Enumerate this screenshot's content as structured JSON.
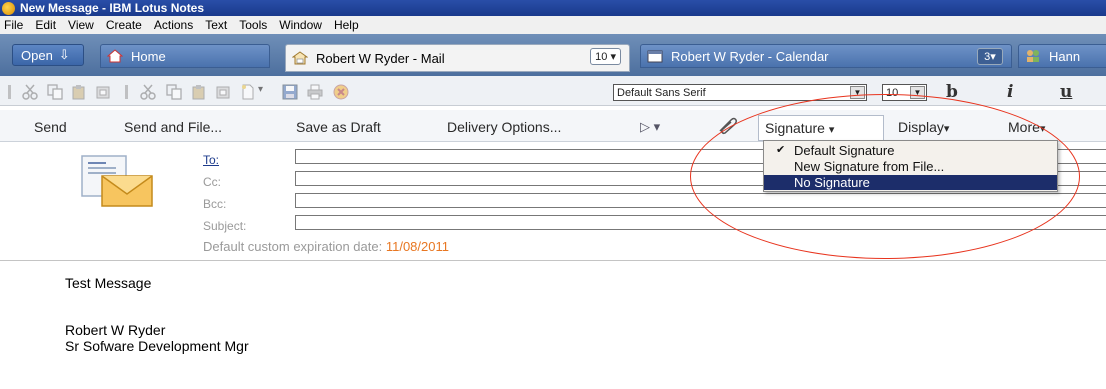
{
  "window": {
    "title": "New Message - IBM Lotus Notes"
  },
  "menubar": {
    "items": [
      "File",
      "Edit",
      "View",
      "Create",
      "Actions",
      "Text",
      "Tools",
      "Window",
      "Help"
    ]
  },
  "tabs": {
    "open_label": "Open",
    "home": "Home",
    "mail": {
      "label": "Robert W Ryder - Mail",
      "count": "10"
    },
    "calendar": {
      "label": "Robert W Ryder - Calendar",
      "count": "3"
    },
    "partial": "Hann"
  },
  "format": {
    "font": "Default Sans Serif",
    "size": "10",
    "bold": "b",
    "italic": "i",
    "underline": "u"
  },
  "actions": {
    "send": "Send",
    "send_file": "Send and File...",
    "save_draft": "Save as Draft",
    "delivery": "Delivery Options...",
    "signature": "Signature",
    "display": "Display",
    "more": "More"
  },
  "signature_menu": {
    "items": [
      "Default Signature",
      "New Signature from File...",
      "No Signature"
    ],
    "checked": "Default Signature",
    "highlighted": "No Signature"
  },
  "address": {
    "to": "To:",
    "cc": "Cc:",
    "bcc": "Bcc:",
    "subject": "Subject:",
    "expiry_label": "Default custom expiration date:",
    "expiry_date": "11/08/2011"
  },
  "body": {
    "line1": "Test Message",
    "line2": "Robert W Ryder",
    "line3": "Sr Sofware Development Mgr"
  },
  "colors": {
    "annotation": "#e8341e",
    "menu_highlight": "#1c2d6a",
    "expiry_date": "#e87722",
    "link": "#1d3b8c"
  }
}
